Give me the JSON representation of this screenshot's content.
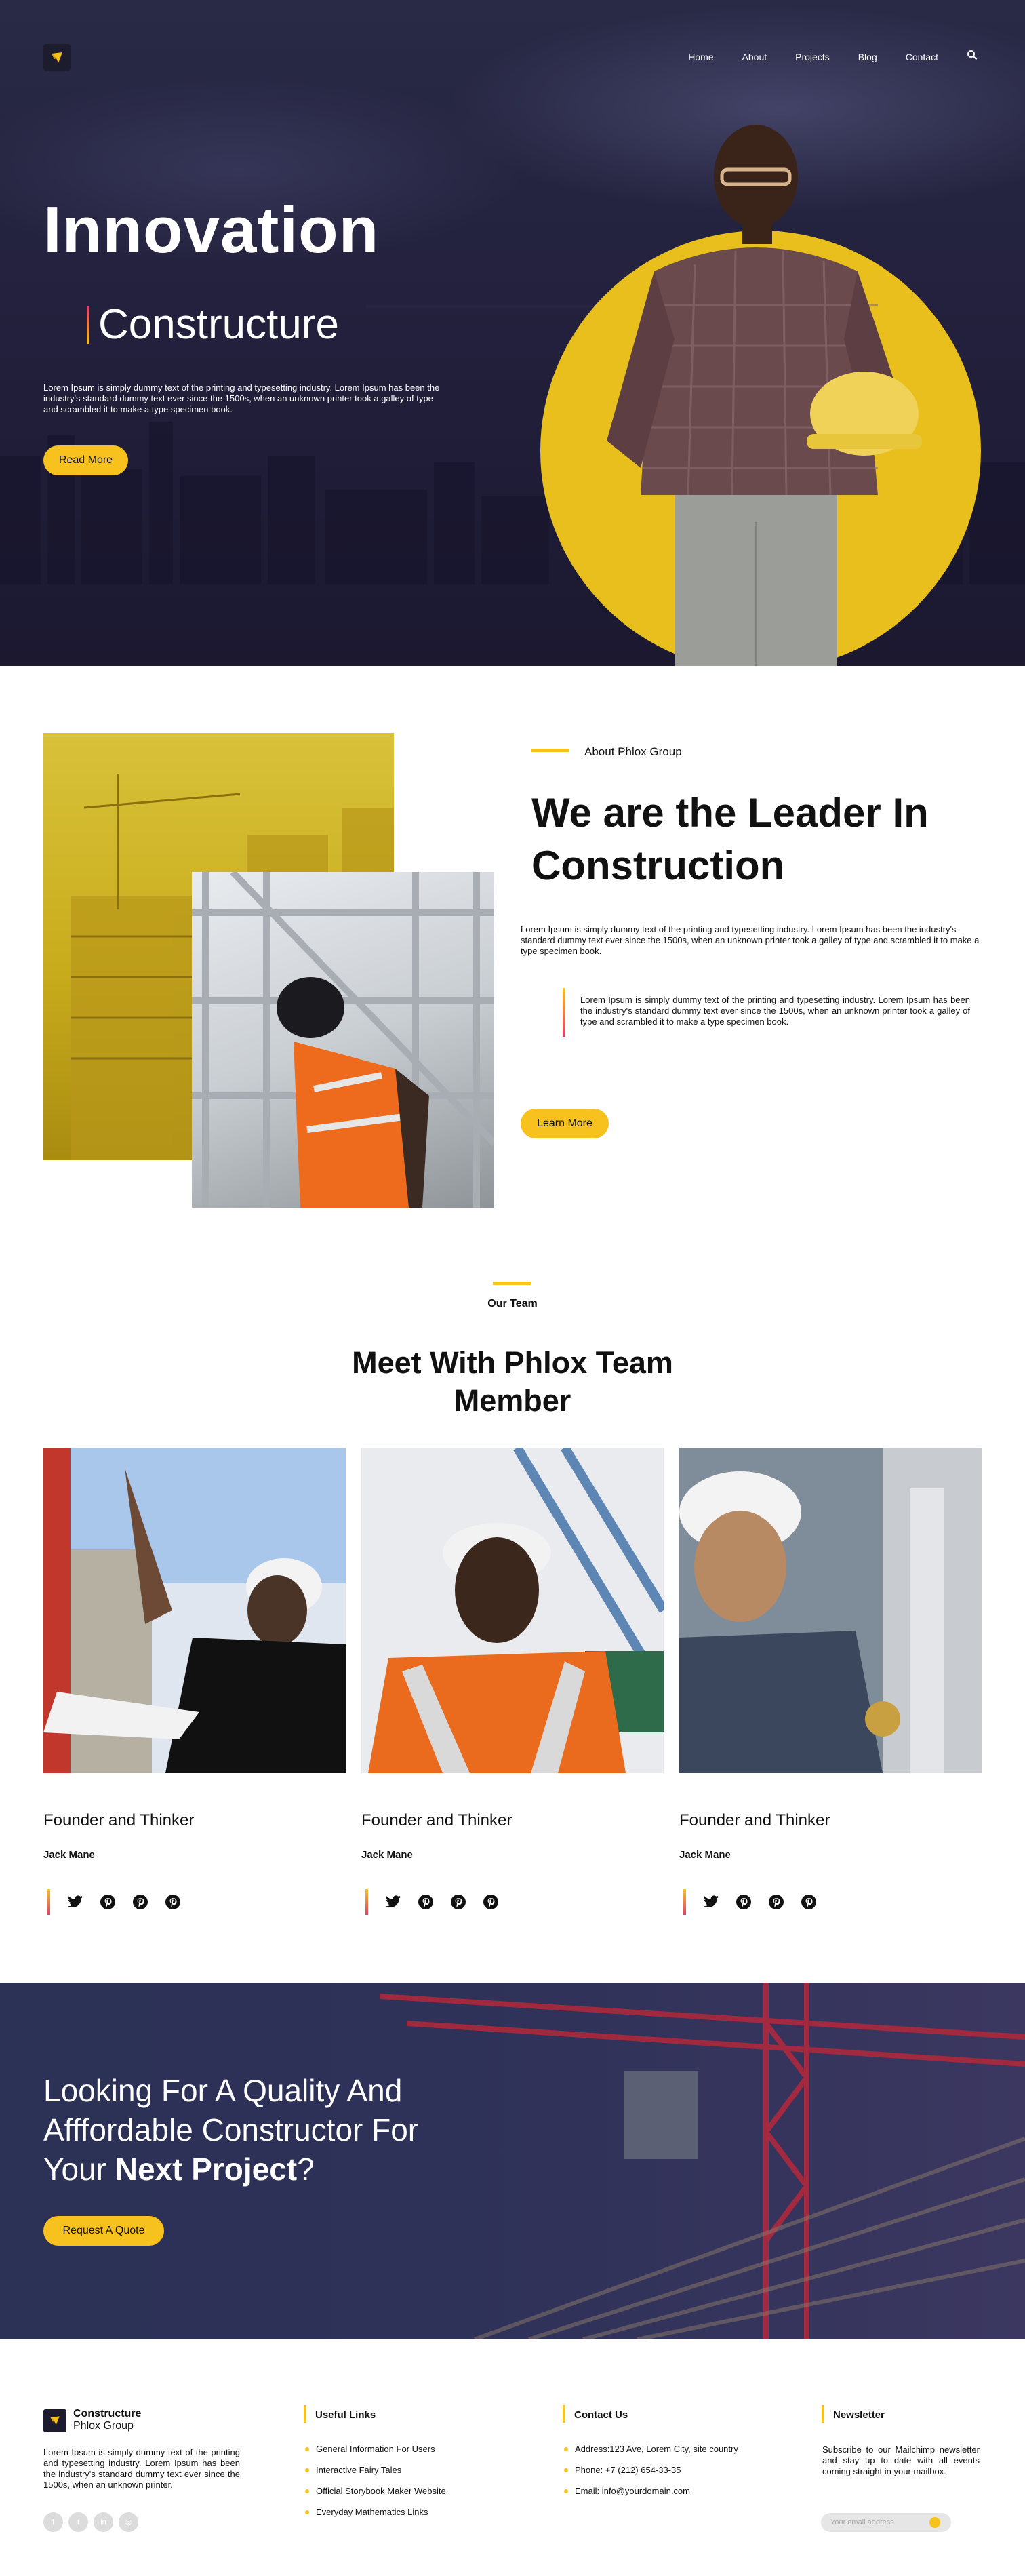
{
  "nav": {
    "items": [
      "Home",
      "About",
      "Projects",
      "Blog",
      "Contact"
    ],
    "search_icon": "search-icon"
  },
  "hero": {
    "title": "Innovation",
    "subtitle": "Constructure",
    "description": "Lorem Ipsum is simply dummy text of the printing and typesetting industry. Lorem Ipsum has been the industry's standard dummy text ever since the 1500s, when an unknown printer took a galley of type and scrambled it to make a type specimen book.",
    "button": "Read More"
  },
  "about": {
    "label": "About Phlox Group",
    "title": "We are the Leader In Construction",
    "paragraph": "Lorem Ipsum is simply dummy text of the printing and typesetting industry. Lorem Ipsum has been the industry's standard dummy text ever since the 1500s, when an unknown printer took a galley of type and scrambled it to make a type specimen book.",
    "quote": "Lorem Ipsum is simply dummy text of the printing and typesetting industry. Lorem Ipsum has been the industry's standard dummy text ever since the 1500s, when an unknown printer took a galley of type and scrambled it to make a type specimen book.",
    "button": "Learn More"
  },
  "team": {
    "label": "Our Team",
    "title": "Meet With Phlox Team Member",
    "members": [
      {
        "role": "Founder and Thinker",
        "name": "Jack Mane"
      },
      {
        "role": "Founder and Thinker",
        "name": "Jack Mane"
      },
      {
        "role": "Founder and Thinker",
        "name": "Jack Mane"
      }
    ]
  },
  "cta": {
    "line1": "Looking For A Quality And",
    "line2": "Afffordable Constructor For",
    "line3_pre": "Your ",
    "line3_bold": "Next Project",
    "line3_post": "?",
    "button": "Request A Quote"
  },
  "footer": {
    "brand_name": "Constructure",
    "brand_sub": "Phlox Group",
    "description": "Lorem Ipsum is simply dummy text of the printing and typesetting industry. Lorem Ipsum has been the industry's standard dummy text ever since the 1500s, when an unknown printer.",
    "useful_links_title": "Useful Links",
    "useful_links": [
      "General Information For Users",
      "Interactive Fairy Tales",
      "Official Storybook Maker Website",
      "Everyday Mathematics Links"
    ],
    "contact_title": "Contact Us",
    "contact": [
      "Address:123 Ave, Lorem City, site country",
      "Phone: +7 (212) 654-33-35",
      "Email: info@yourdomain.com"
    ],
    "newsletter_title": "Newsletter",
    "newsletter_text": "Subscribe to our Mailchimp newsletter and stay up to date with all events coming straight in your mailbox.",
    "email_placeholder": "Your email address"
  },
  "colors": {
    "accent": "#f7c21d",
    "hero_bg": "#221f3b",
    "cta_bg": "#2e3158"
  }
}
